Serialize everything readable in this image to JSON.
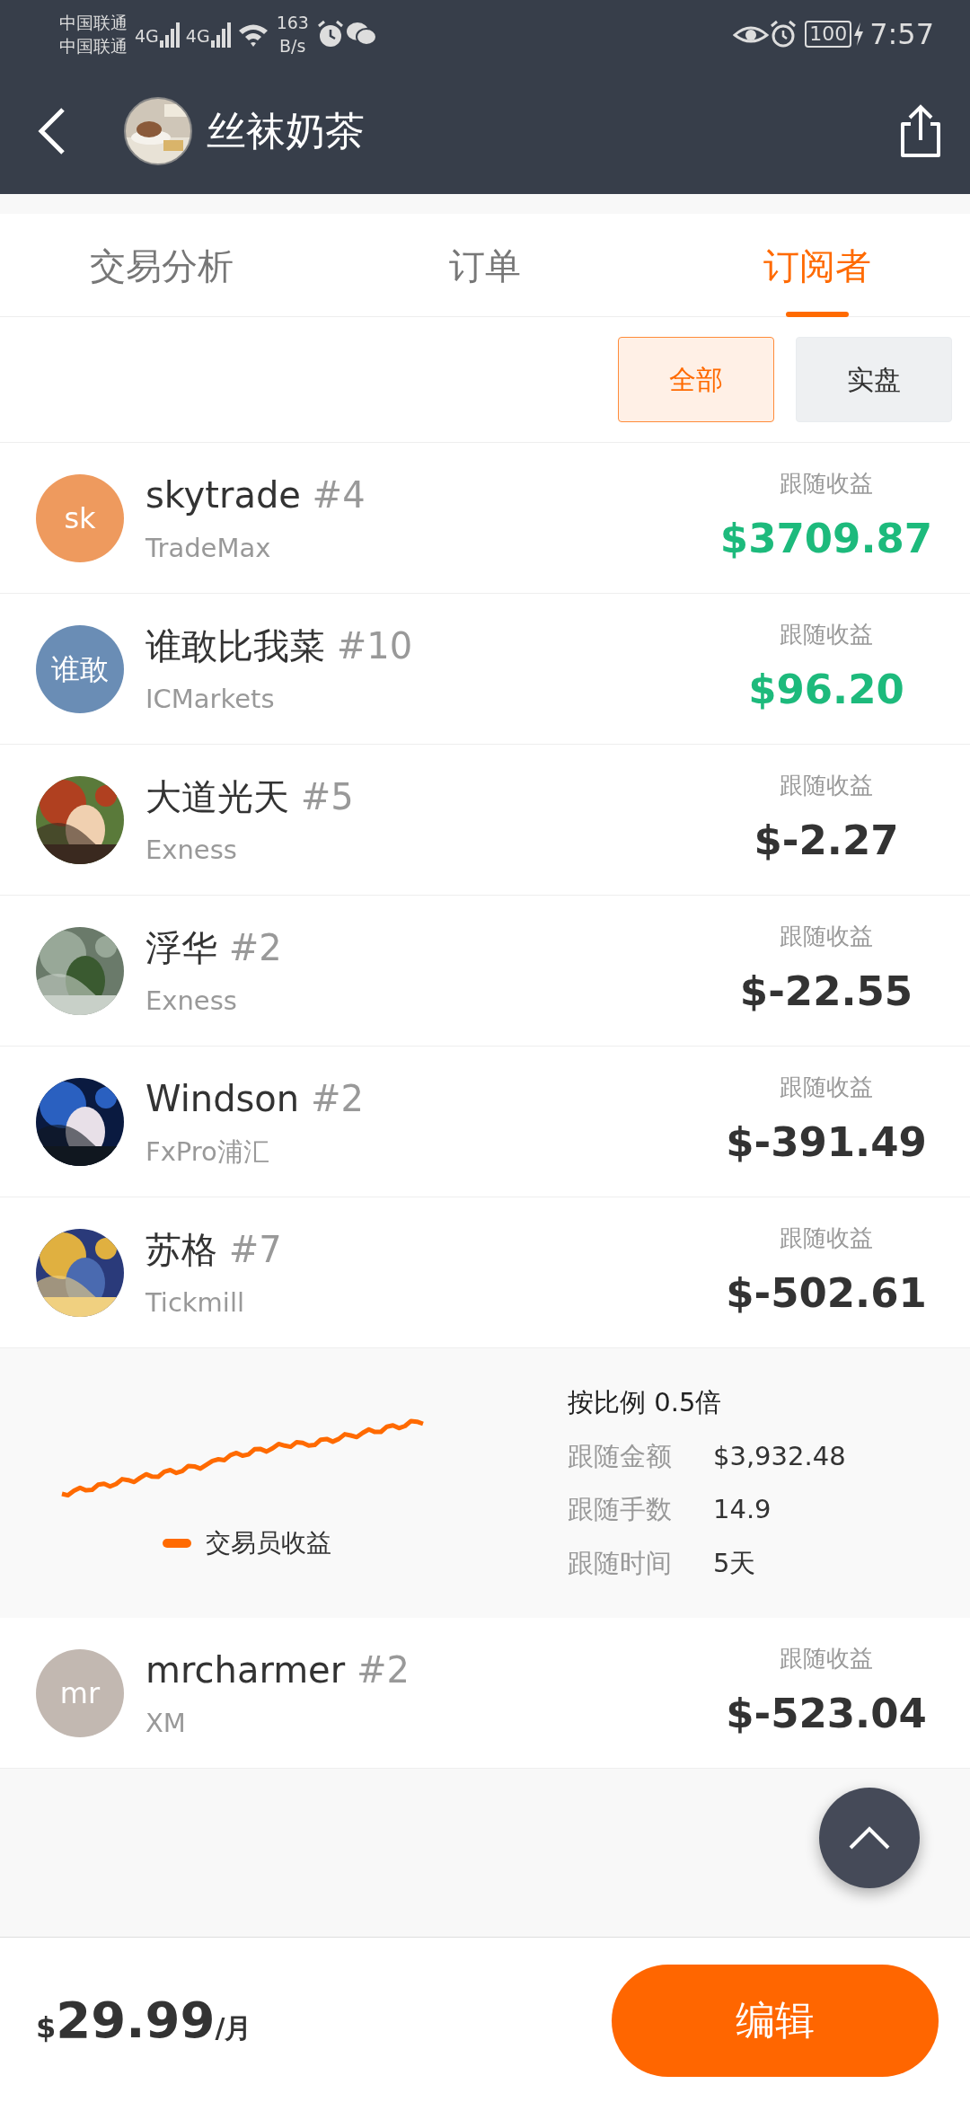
{
  "status_bar": {
    "carriers": [
      "中国联通",
      "中国联通"
    ],
    "network": [
      "4G",
      "4G"
    ],
    "speed": "163",
    "speed_unit": "B/s",
    "battery": "100",
    "time": "7:57"
  },
  "header": {
    "title": "丝袜奶茶"
  },
  "tabs": [
    {
      "label": "交易分析",
      "selected": false
    },
    {
      "label": "订单",
      "selected": false
    },
    {
      "label": "订阅者",
      "selected": true
    }
  ],
  "filters": [
    {
      "label": "全部",
      "selected": true
    },
    {
      "label": "实盘",
      "selected": false
    }
  ],
  "subscribers": [
    {
      "name": "skytrade",
      "rank": "#4",
      "broker": "TradeMax",
      "avatar": {
        "kind": "initials",
        "text": "sk",
        "color": "#ee9a5e"
      },
      "profit_label": "跟随收益",
      "profit": "$3709.87",
      "color": "#1dba7c"
    },
    {
      "name": "谁敢比我菜",
      "rank": "#10",
      "broker": "ICMarkets",
      "avatar": {
        "kind": "initials",
        "text": "谁敢",
        "color": "#6a8db5"
      },
      "profit_label": "跟随收益",
      "profit": "$96.20",
      "color": "#1dba7c"
    },
    {
      "name": "大道光天",
      "rank": "#5",
      "broker": "Exness",
      "profit_label": "跟随收益",
      "profit": "$-2.27",
      "color": "#333333"
    },
    {
      "name": "浮华",
      "rank": "#2",
      "broker": "Exness",
      "profit_label": "跟随收益",
      "profit": "$-22.55",
      "color": "#333333"
    },
    {
      "name": "Windson",
      "rank": "#2",
      "broker": "FxPro浦汇",
      "profit_label": "跟随收益",
      "profit": "$-391.49",
      "color": "#333333"
    },
    {
      "name": "苏格",
      "rank": "#7",
      "broker": "Tickmill",
      "profit_label": "跟随收益",
      "profit": "$-502.61",
      "color": "#333333",
      "expanded": true,
      "details": {
        "legend": "交易员收益",
        "ratio": "按比例 0.5倍",
        "stats": [
          {
            "label": "跟随金额",
            "value": "$3,932.48"
          },
          {
            "label": "跟随手数",
            "value": "14.9"
          },
          {
            "label": "跟随时间",
            "value": "5天"
          }
        ]
      }
    },
    {
      "name": "mrcharmer",
      "rank": "#2",
      "broker": "XM",
      "avatar": {
        "kind": "initials",
        "text": "mr",
        "color": "#c2b8b1"
      },
      "profit_label": "跟随收益",
      "profit": "$-523.04",
      "color": "#333333"
    }
  ],
  "footer": {
    "currency": "$",
    "price": "29.99",
    "period": "/月",
    "button": "编辑"
  }
}
